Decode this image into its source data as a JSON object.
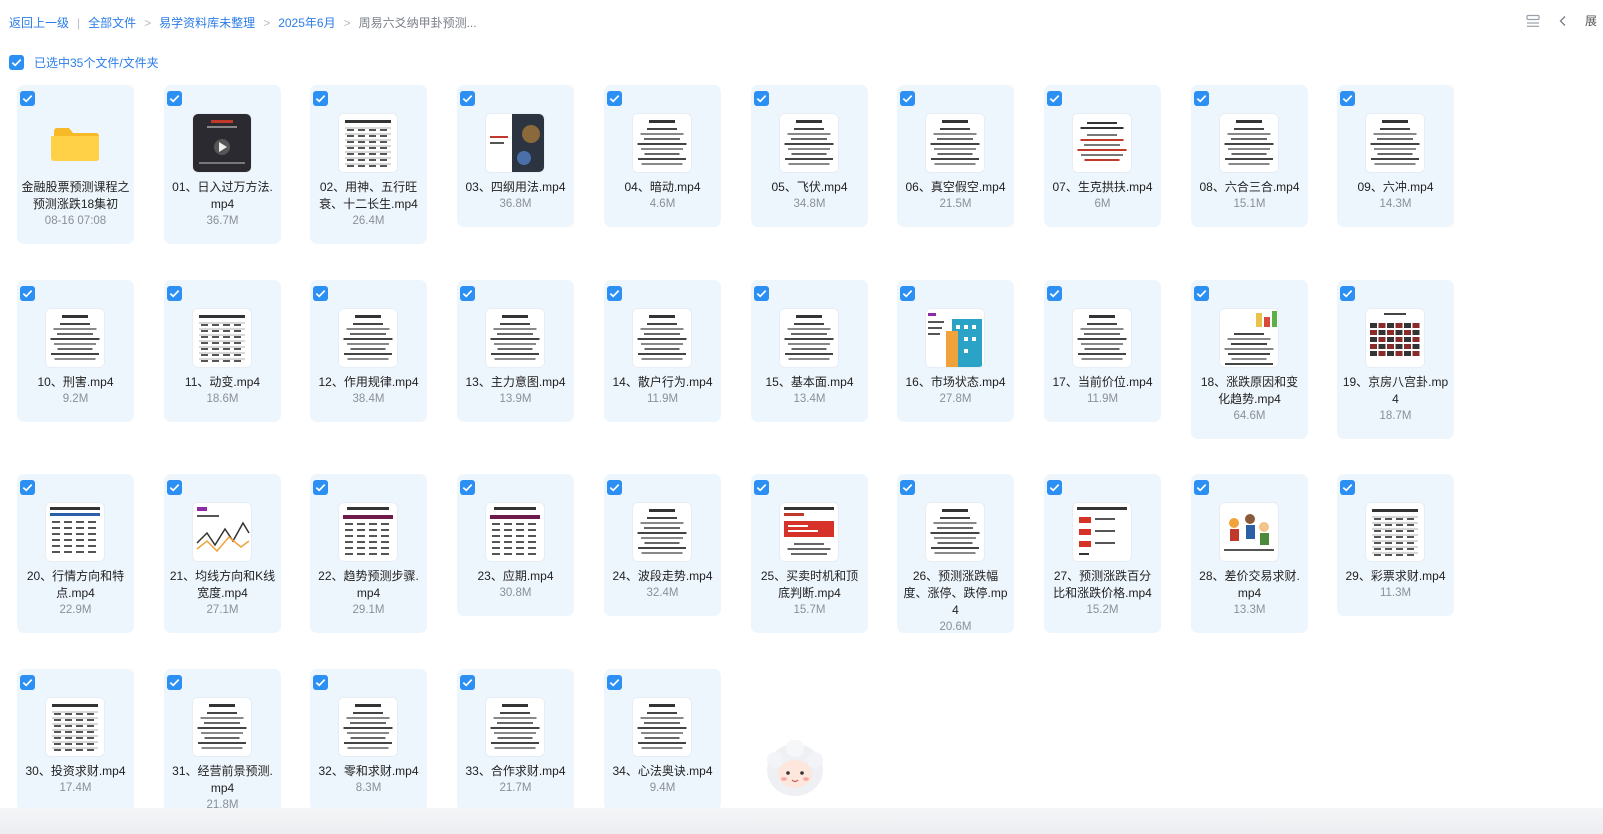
{
  "breadcrumb": {
    "back": "返回上一级",
    "separator": "|",
    "items": [
      "全部文件",
      "易学资料库未整理",
      "2025年6月"
    ],
    "current": "周易六爻纳甲卦预测..."
  },
  "top_right": {
    "list_view_icon": "list-view-icon",
    "collapse_icon": "chevron-left-icon",
    "expand_label": "展"
  },
  "selection": {
    "text": "已选中35个文件/文件夹"
  },
  "accent_color": "#2b8ff3",
  "files": [
    {
      "name": "金融股票预测课程之预测涨跌18集初",
      "meta": "08-16 07:08",
      "type": "folder"
    },
    {
      "name": "01、日入过万方法.mp4",
      "meta": "36.7M",
      "type": "video-dark"
    },
    {
      "name": "02、用神、五行旺衰、十二长生.mp4",
      "meta": "26.4M",
      "type": "doc-table"
    },
    {
      "name": "03、四纲用法.mp4",
      "meta": "36.8M",
      "type": "doc-image"
    },
    {
      "name": "04、暗动.mp4",
      "meta": "4.6M",
      "type": "doc"
    },
    {
      "name": "05、飞伏.mp4",
      "meta": "34.8M",
      "type": "doc"
    },
    {
      "name": "06、真空假空.mp4",
      "meta": "21.5M",
      "type": "doc"
    },
    {
      "name": "07、生克拱扶.mp4",
      "meta": "6M",
      "type": "doc-red"
    },
    {
      "name": "08、六合三合.mp4",
      "meta": "15.1M",
      "type": "doc"
    },
    {
      "name": "09、六冲.mp4",
      "meta": "14.3M",
      "type": "doc"
    },
    {
      "name": "10、刑害.mp4",
      "meta": "9.2M",
      "type": "doc"
    },
    {
      "name": "11、动变.mp4",
      "meta": "18.6M",
      "type": "doc-table"
    },
    {
      "name": "12、作用规律.mp4",
      "meta": "38.4M",
      "type": "doc"
    },
    {
      "name": "13、主力意图.mp4",
      "meta": "13.9M",
      "type": "doc"
    },
    {
      "name": "14、散户行为.mp4",
      "meta": "11.9M",
      "type": "doc"
    },
    {
      "name": "15、基本面.mp4",
      "meta": "13.4M",
      "type": "doc"
    },
    {
      "name": "16、市场状态.mp4",
      "meta": "27.8M",
      "type": "doc-building"
    },
    {
      "name": "17、当前价位.mp4",
      "meta": "11.9M",
      "type": "doc"
    },
    {
      "name": "18、涨跌原因和变化趋势.mp4",
      "meta": "64.6M",
      "type": "doc-chart"
    },
    {
      "name": "19、京房八宫卦.mp4",
      "meta": "18.7M",
      "type": "doc-table-dark"
    },
    {
      "name": "20、行情方向和特点.mp4",
      "meta": "22.9M",
      "type": "doc-table-blue"
    },
    {
      "name": "21、均线方向和K线宽度.mp4",
      "meta": "27.1M",
      "type": "doc-line"
    },
    {
      "name": "22、趋势预测步骤.mp4",
      "meta": "29.1M",
      "type": "doc-table-purple"
    },
    {
      "name": "23、应期.mp4",
      "meta": "30.8M",
      "type": "doc-table-purple"
    },
    {
      "name": "24、波段走势.mp4",
      "meta": "32.4M",
      "type": "doc"
    },
    {
      "name": "25、买卖时机和顶底判断.mp4",
      "meta": "15.7M",
      "type": "doc-red-banner"
    },
    {
      "name": "26、预测涨跌幅度、涨停、跌停.mp4",
      "meta": "20.6M",
      "type": "doc"
    },
    {
      "name": "27、预测涨跌百分比和涨跌价格.mp4",
      "meta": "15.2M",
      "type": "doc-red-boxes"
    },
    {
      "name": "28、差价交易求财.mp4",
      "meta": "13.3M",
      "type": "doc-people"
    },
    {
      "name": "29、彩票求财.mp4",
      "meta": "11.3M",
      "type": "doc-table"
    },
    {
      "name": "30、投资求财.mp4",
      "meta": "17.4M",
      "type": "doc-table"
    },
    {
      "name": "31、经营前景预测.mp4",
      "meta": "21.8M",
      "type": "doc"
    },
    {
      "name": "32、零和求财.mp4",
      "meta": "8.3M",
      "type": "doc"
    },
    {
      "name": "33、合作求财.mp4",
      "meta": "21.7M",
      "type": "doc"
    },
    {
      "name": "34、心法奥诀.mp4",
      "meta": "9.4M",
      "type": "doc"
    }
  ]
}
